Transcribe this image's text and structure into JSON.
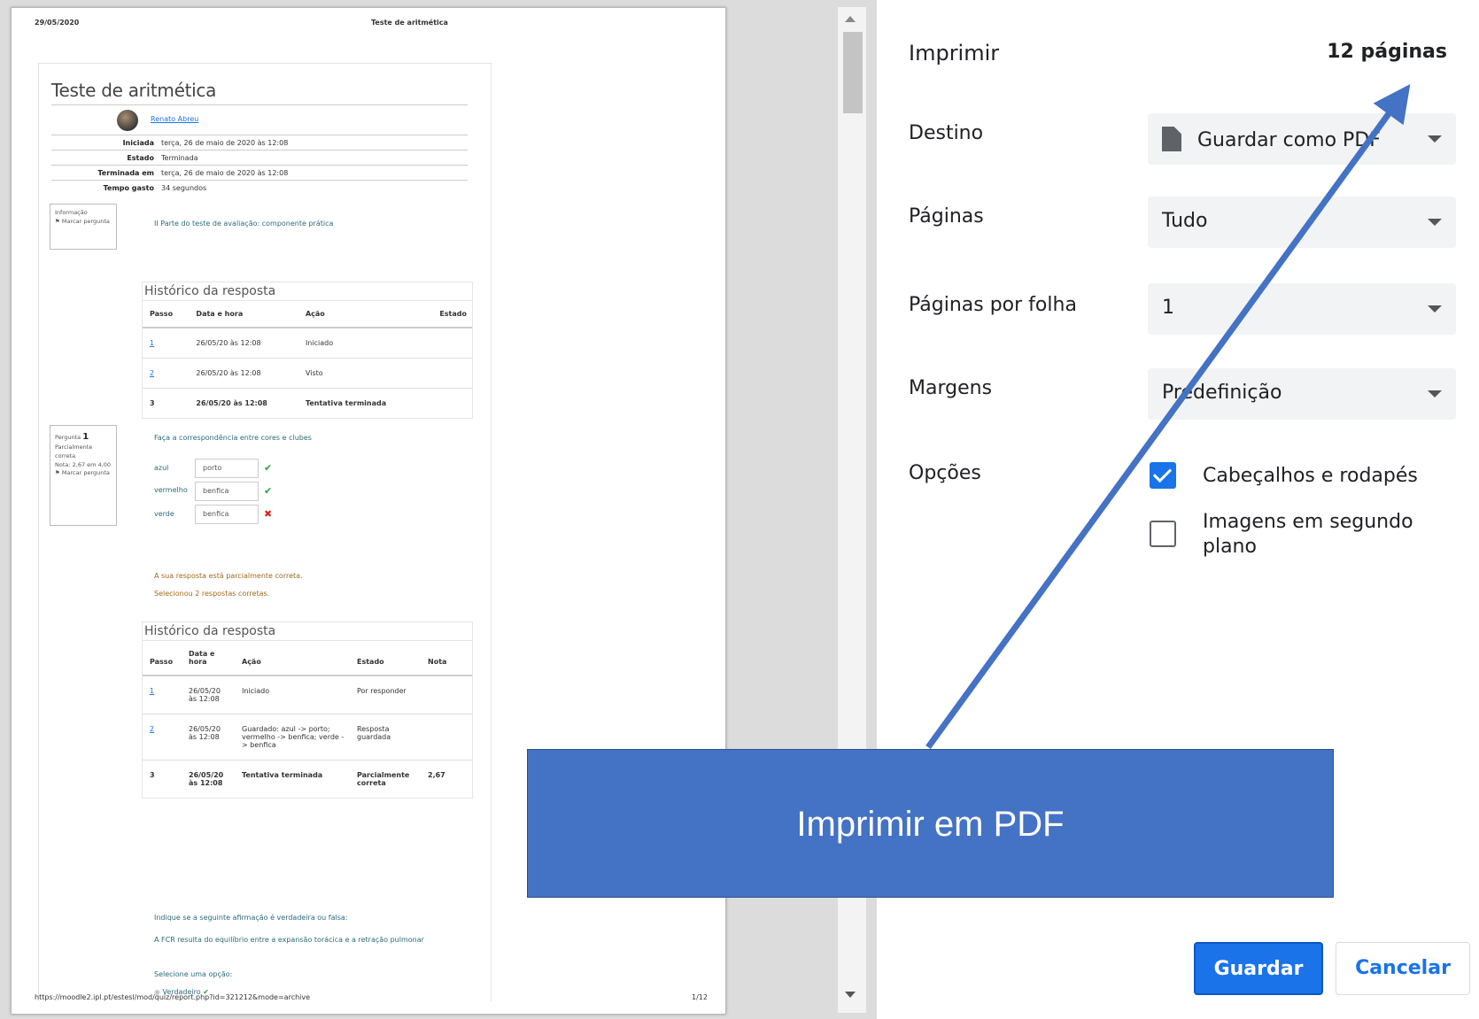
{
  "preview": {
    "header_date": "29/05/2020",
    "header_title": "Teste de aritmética",
    "footer_url": "https://moodle2.ipl.pt/estesl/mod/quiz/report.php?id=321212&mode=archive",
    "footer_page": "1/12",
    "quiz_title": "Teste de aritmética",
    "user_name": "Renato Abreu",
    "summary": [
      {
        "key": "Iniciada",
        "value": "terça, 26 de maio de 2020 às 12:08"
      },
      {
        "key": "Estado",
        "value": "Terminada"
      },
      {
        "key": "Terminada em",
        "value": "terça, 26 de maio de 2020 às 12:08"
      },
      {
        "key": "Tempo gasto",
        "value": "34 segundos"
      }
    ],
    "info_box": {
      "title": "Informação",
      "flag": "Marcar pergunta"
    },
    "info_text": "II Parte do teste de avaliação: componente prática",
    "history1": {
      "title": "Histórico da resposta",
      "headers": [
        "Passo",
        "Data e hora",
        "Ação",
        "Estado"
      ],
      "rows": [
        [
          "1",
          "26/05/20 às 12:08",
          "Iniciado",
          ""
        ],
        [
          "2",
          "26/05/20 às 12:08",
          "Visto",
          ""
        ],
        [
          "3",
          "26/05/20 às 12:08",
          "Tentativa terminada",
          ""
        ]
      ]
    },
    "q1_box": {
      "label": "Pergunta",
      "number": "1",
      "status": "Parcialmente correta",
      "grade": "Nota: 2,67 em 4,00",
      "flag": "Marcar pergunta"
    },
    "q1_text": "Faça a correspondência entre cores e clubes",
    "matches": [
      {
        "color": "azul",
        "answer": "porto",
        "correct": true
      },
      {
        "color": "vermelho",
        "answer": "benfica",
        "correct": true
      },
      {
        "color": "verde",
        "answer": "benfica",
        "correct": false
      }
    ],
    "feedback1": "A sua resposta está parcialmente correta.",
    "feedback2": "Selecionou 2 respostas corretas.",
    "history2": {
      "title": "Histórico da resposta",
      "headers": [
        "Passo",
        "Data e hora",
        "Ação",
        "Estado",
        "Nota"
      ],
      "rows": [
        [
          "1",
          "26/05/20 às 12:08",
          "Iniciado",
          "Por responder",
          ""
        ],
        [
          "2",
          "26/05/20 às 12:08",
          "Guardado: azul -> porto; vermelho -> benfica; verde -> benfica",
          "Resposta guardada",
          ""
        ],
        [
          "3",
          "26/05/20 às 12:08",
          "Tentativa terminada",
          "Parcialmente correta",
          "2,67"
        ]
      ]
    },
    "q2_text": "Indique se a seguinte afirmação é verdadeira ou falsa:",
    "q2_statement": "A FCR resulta do equilíbrio entre a expansão torácica e a retração pulmonar",
    "q2_select": "Selecione uma opção:",
    "q2_option": "Verdadeiro"
  },
  "panel": {
    "title": "Imprimir",
    "pages_count": "12 páginas",
    "destination": {
      "label": "Destino",
      "value": "Guardar como PDF"
    },
    "pages": {
      "label": "Páginas",
      "value": "Tudo"
    },
    "per_sheet": {
      "label": "Páginas por folha",
      "value": "1"
    },
    "margins": {
      "label": "Margens",
      "value": "Predefinição"
    },
    "options": {
      "label": "Opções",
      "headers_footers": "Cabeçalhos e rodapés",
      "headers_footers_checked": true,
      "background": "Imagens em segundo plano",
      "background_checked": false
    },
    "save_button": "Guardar",
    "cancel_button": "Cancelar"
  },
  "annotation": {
    "text": "Imprimir em PDF",
    "color": "#4472c4"
  }
}
